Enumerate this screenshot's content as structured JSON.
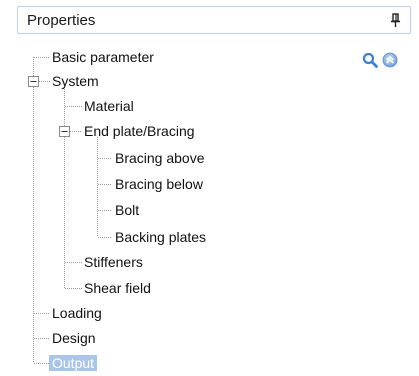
{
  "panel": {
    "title": "Properties",
    "pin_icon": "pin-icon",
    "search_icon": "search-icon",
    "collapse_icon": "collapse-all-icon"
  },
  "tree": {
    "items": [
      {
        "label": "Basic parameter"
      },
      {
        "label": "System",
        "expanded": true
      },
      {
        "label": "Material"
      },
      {
        "label": "End plate/Bracing",
        "expanded": true
      },
      {
        "label": "Bracing above"
      },
      {
        "label": "Bracing below"
      },
      {
        "label": "Bolt"
      },
      {
        "label": "Backing plates"
      },
      {
        "label": "Stiffeners"
      },
      {
        "label": "Shear field"
      },
      {
        "label": "Loading"
      },
      {
        "label": "Design"
      },
      {
        "label": "Output",
        "selected": true
      }
    ]
  },
  "colors": {
    "header_border": "#bcd0e6",
    "selection": "#a9c6ea",
    "icon_blue": "#3b7fd6"
  }
}
